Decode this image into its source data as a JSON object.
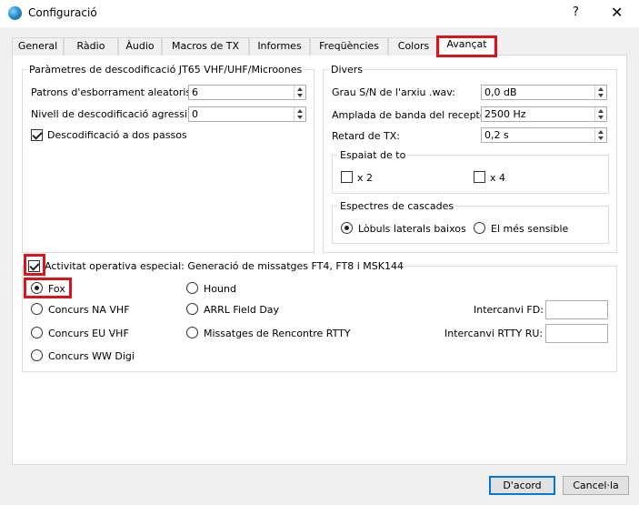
{
  "window": {
    "title": "Configuració",
    "help_glyph": "?",
    "close_glyph": "✕"
  },
  "tabs": [
    {
      "label": "General"
    },
    {
      "label": "Ràdio"
    },
    {
      "label": "Àudio"
    },
    {
      "label": "Macros de TX"
    },
    {
      "label": "Informes"
    },
    {
      "label": "Freqüències"
    },
    {
      "label": "Colors"
    },
    {
      "label": "Avançat",
      "active": true
    }
  ],
  "decode_group": {
    "title": "Paràmetres de descodificació JT65 VHF/UHF/Microones",
    "random_erasure_label": "Patrons d'esborrament aleatoris:",
    "random_erasure_value": "6",
    "aggressive_label": "Nivell de descodificació agressiu:",
    "aggressive_value": "0",
    "two_pass_label": "Descodificació a dos passos",
    "two_pass_checked": true
  },
  "misc_group": {
    "title": "Divers",
    "snr_label": "Grau S/N de l'arxiu .wav:",
    "snr_value": "0,0 dB",
    "bandwidth_label": "Amplada de banda del receptor:",
    "bandwidth_value": "2500  Hz",
    "tx_delay_label": "Retard de TX:",
    "tx_delay_value": "0,2  s",
    "tone_spacing": {
      "title": "Espaiat de to",
      "x2_label": "x 2",
      "x4_label": "x 4"
    },
    "waterfall": {
      "title": "Espectres de cascades",
      "low_sidelobes_label": "Lòbuls laterals baixos",
      "most_sensitive_label": "El més sensible",
      "selected": "low_sidelobes"
    }
  },
  "special_ops": {
    "label": "Activitat operativa especial: Generació de missatges FT4, FT8 i MSK144",
    "checked": true,
    "options": {
      "fox": "Fox",
      "hound": "Hound",
      "na_vhf": "Concurs NA VHF",
      "arrl_field_day": "ARRL Field Day",
      "eu_vhf": "Concurs EU VHF",
      "rtty": "Missatges de Rencontre RTTY",
      "ww_digi": "Concurs WW Digi"
    },
    "selected": "fox",
    "fd_exchange_label": "Intercanvi FD:",
    "fd_exchange_value": "",
    "rtty_exchange_label": "Intercanvi RTTY RU:",
    "rtty_exchange_value": ""
  },
  "buttons": {
    "ok": "D'acord",
    "cancel": "Cancel·la"
  },
  "colors": {
    "highlight": "#d8141e",
    "default_button_border": "#0078d7"
  }
}
